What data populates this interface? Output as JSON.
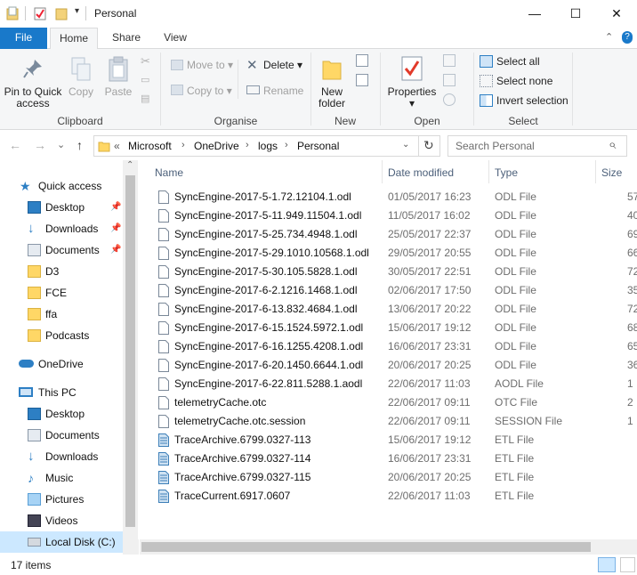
{
  "window": {
    "title": "Personal",
    "minimize_icon": "minimize-icon",
    "maximize_icon": "maximize-icon",
    "close_icon": "close-icon",
    "minimize_glyph": "—",
    "maximize_glyph": "☐",
    "close_glyph": "✕",
    "qa_dropdown_glyph": "▾"
  },
  "tabs": [
    {
      "label": "File"
    },
    {
      "label": "Home"
    },
    {
      "label": "Share"
    },
    {
      "label": "View"
    }
  ],
  "ribbon_extra": {
    "collapse_glyph": "⌃",
    "help_glyph": "?"
  },
  "ribbon": {
    "clipboard": {
      "group_label": "Clipboard",
      "pin_label": "Pin to Quick access",
      "copy_label": "Copy",
      "paste_label": "Paste"
    },
    "organise": {
      "group_label": "Organise",
      "move_to": "Move to",
      "copy_to": "Copy to",
      "delete": "Delete",
      "rename": "Rename"
    },
    "new": {
      "group_label": "New",
      "new_folder": "New folder"
    },
    "open": {
      "group_label": "Open",
      "properties": "Properties"
    },
    "select": {
      "group_label": "Select",
      "select_all": "Select all",
      "select_none": "Select none",
      "invert": "Invert selection"
    }
  },
  "address": {
    "back_glyph": "←",
    "forward_glyph": "→",
    "recent_glyph": "⌄",
    "up_glyph": "↑",
    "overflow": "«",
    "breadcrumbs": [
      "Microsoft",
      "OneDrive",
      "logs",
      "Personal"
    ],
    "separator": "›",
    "refresh_glyph": "↻",
    "search_placeholder": "Search Personal",
    "search_glyph": "⌕"
  },
  "nav": {
    "pin_glyph": "📌",
    "scroll_up_glyph": "⌃",
    "scroll_down_glyph": "⌄",
    "quick_access": "Quick access",
    "qa_items": [
      {
        "label": "Desktop",
        "pinned": true
      },
      {
        "label": "Downloads",
        "pinned": true
      },
      {
        "label": "Documents",
        "pinned": true
      },
      {
        "label": "D3",
        "pinned": false
      },
      {
        "label": "FCE",
        "pinned": false
      },
      {
        "label": "ffa",
        "pinned": false
      },
      {
        "label": "Podcasts",
        "pinned": false
      }
    ],
    "onedrive": "OneDrive",
    "this_pc": "This PC",
    "pc_items": [
      {
        "label": "Desktop"
      },
      {
        "label": "Documents"
      },
      {
        "label": "Downloads"
      },
      {
        "label": "Music"
      },
      {
        "label": "Pictures"
      },
      {
        "label": "Videos"
      },
      {
        "label": "Local Disk (C:)"
      }
    ]
  },
  "columns": {
    "name": "Name",
    "date": "Date modified",
    "type": "Type",
    "size": "Size"
  },
  "files": [
    {
      "name": "SyncEngine-2017-5-1.72.12104.1.odl",
      "date": "01/05/2017 16:23",
      "type": "ODL File",
      "size": "57",
      "icon": "file"
    },
    {
      "name": "SyncEngine-2017-5-11.949.11504.1.odl",
      "date": "11/05/2017 16:02",
      "type": "ODL File",
      "size": "40",
      "icon": "file"
    },
    {
      "name": "SyncEngine-2017-5-25.734.4948.1.odl",
      "date": "25/05/2017 22:37",
      "type": "ODL File",
      "size": "69",
      "icon": "file"
    },
    {
      "name": "SyncEngine-2017-5-29.1010.10568.1.odl",
      "date": "29/05/2017 20:55",
      "type": "ODL File",
      "size": "66",
      "icon": "file"
    },
    {
      "name": "SyncEngine-2017-5-30.105.5828.1.odl",
      "date": "30/05/2017 22:51",
      "type": "ODL File",
      "size": "72",
      "icon": "file"
    },
    {
      "name": "SyncEngine-2017-6-2.1216.1468.1.odl",
      "date": "02/06/2017 17:50",
      "type": "ODL File",
      "size": "35",
      "icon": "file"
    },
    {
      "name": "SyncEngine-2017-6-13.832.4684.1.odl",
      "date": "13/06/2017 20:22",
      "type": "ODL File",
      "size": "72",
      "icon": "file"
    },
    {
      "name": "SyncEngine-2017-6-15.1524.5972.1.odl",
      "date": "15/06/2017 19:12",
      "type": "ODL File",
      "size": "68",
      "icon": "file"
    },
    {
      "name": "SyncEngine-2017-6-16.1255.4208.1.odl",
      "date": "16/06/2017 23:31",
      "type": "ODL File",
      "size": "65",
      "icon": "file"
    },
    {
      "name": "SyncEngine-2017-6-20.1450.6644.1.odl",
      "date": "20/06/2017 20:25",
      "type": "ODL File",
      "size": "36",
      "icon": "file"
    },
    {
      "name": "SyncEngine-2017-6-22.811.5288.1.aodl",
      "date": "22/06/2017 11:03",
      "type": "AODL File",
      "size": "1",
      "icon": "file"
    },
    {
      "name": "telemetryCache.otc",
      "date": "22/06/2017 09:11",
      "type": "OTC File",
      "size": "2",
      "icon": "file"
    },
    {
      "name": "telemetryCache.otc.session",
      "date": "22/06/2017 09:11",
      "type": "SESSION File",
      "size": "1",
      "icon": "file"
    },
    {
      "name": "TraceArchive.6799.0327-113",
      "date": "15/06/2017 19:12",
      "type": "ETL File",
      "size": "",
      "icon": "etl"
    },
    {
      "name": "TraceArchive.6799.0327-114",
      "date": "16/06/2017 23:31",
      "type": "ETL File",
      "size": "",
      "icon": "etl"
    },
    {
      "name": "TraceArchive.6799.0327-115",
      "date": "20/06/2017 20:25",
      "type": "ETL File",
      "size": "",
      "icon": "etl"
    },
    {
      "name": "TraceCurrent.6917.0607",
      "date": "22/06/2017 11:03",
      "type": "ETL File",
      "size": "",
      "icon": "etl"
    }
  ],
  "status": {
    "count": "17 items"
  },
  "colors": {
    "accent": "#1979ca",
    "selected": "#cce8ff",
    "folder": "#ffd766"
  }
}
